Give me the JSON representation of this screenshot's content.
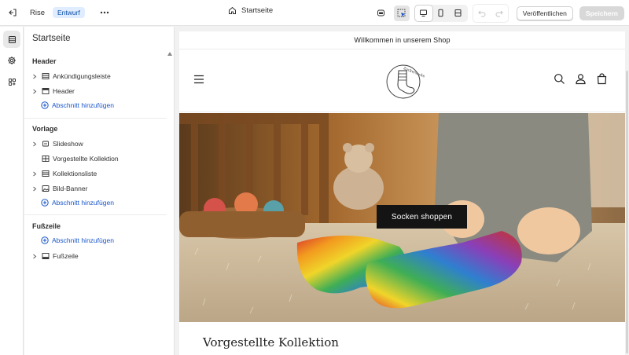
{
  "topbar": {
    "theme_name": "Rise",
    "status_badge": "Entwurf",
    "page_label": "Startseite",
    "publish_label": "Veröffentlichen",
    "save_label": "Speichern"
  },
  "sidebar": {
    "title": "Startseite",
    "groups": [
      {
        "title": "Header",
        "items": [
          {
            "label": "Ankündigungsleiste",
            "icon": "rows-icon",
            "expandable": true
          },
          {
            "label": "Header",
            "icon": "header-layout-icon",
            "expandable": true
          }
        ],
        "add_label": "Abschnitt hinzufügen"
      },
      {
        "title": "Vorlage",
        "items": [
          {
            "label": "Slideshow",
            "icon": "slideshow-icon",
            "expandable": true
          },
          {
            "label": "Vorgestellte Kollektion",
            "icon": "grid-icon",
            "expandable": false
          },
          {
            "label": "Kollektionsliste",
            "icon": "rows-icon",
            "expandable": true
          },
          {
            "label": "Bild-Banner",
            "icon": "image-icon",
            "expandable": true
          }
        ],
        "add_label": "Abschnitt hinzufügen"
      },
      {
        "title": "Fußzeile",
        "add_label": "Abschnitt hinzufügen",
        "items": [
          {
            "label": "Fußzeile",
            "icon": "footer-layout-icon",
            "expandable": true
          }
        ]
      }
    ]
  },
  "preview": {
    "announcement": "Willkommen in unserem Shop",
    "logo_text": "Zuckersocke",
    "hero_button": "Socken shoppen",
    "collection_title": "Vorgestellte Kollektion"
  },
  "colors": {
    "accent_link": "#1a56c9",
    "badge_bg": "#e0ecff",
    "hero_button_bg": "#141414"
  }
}
